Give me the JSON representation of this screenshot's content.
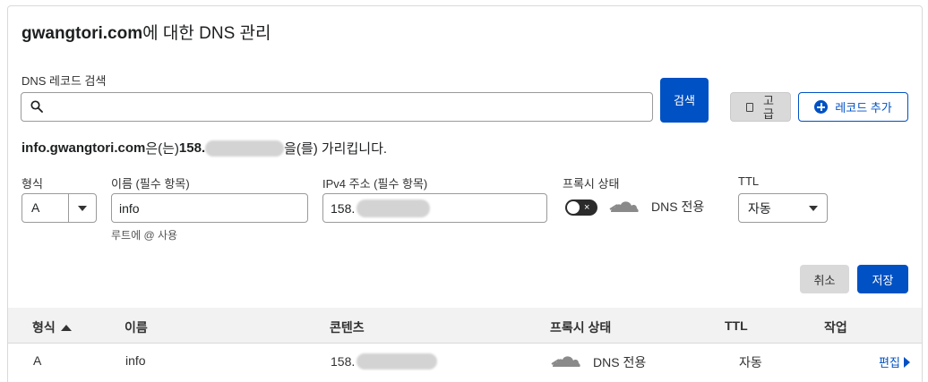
{
  "page": {
    "title_domain": "gwangtori.com",
    "title_suffix": "에 대한 DNS 관리"
  },
  "search": {
    "label": "DNS 레코드 검색",
    "value": "",
    "placeholder": "",
    "search_button": "검색",
    "advanced_button": "고급",
    "add_record_button": "레코드 추가"
  },
  "points_to": {
    "host": "info.gwangtori.com",
    "mid": "은(는) ",
    "ip_visible": "158.",
    "suffix": "을(를) 가리킵니다."
  },
  "form": {
    "type_label": "형식",
    "type_value": "A",
    "name_label": "이름 (필수 항목)",
    "name_value": "info",
    "name_hint": "루트에 @ 사용",
    "ipv4_label": "IPv4 주소 (필수 항목)",
    "ipv4_value": "158.",
    "proxy_label": "프록시 상태",
    "proxy_toggle_mark": "×",
    "proxy_text": "DNS 전용",
    "ttl_label": "TTL",
    "ttl_value": "자동",
    "cancel_button": "취소",
    "save_button": "저장"
  },
  "table": {
    "headers": {
      "type": "형식",
      "name": "이름",
      "content": "콘텐츠",
      "proxy": "프록시 상태",
      "ttl": "TTL",
      "action": "작업"
    },
    "rows": [
      {
        "type": "A",
        "name": "info",
        "content": "158.",
        "proxy": "DNS 전용",
        "ttl": "자동",
        "action": "편집"
      }
    ]
  },
  "colors": {
    "primary": "#0051c3",
    "secondary_button": "#d9d9d9",
    "header_bg": "#f2f2f2",
    "cloud_grey": "#8a8a8a"
  },
  "icons": {
    "search": "magnifier-icon",
    "add": "plus-circle-icon",
    "advanced": "document-icon",
    "proxy": "cloud-icon",
    "sort": "sort-ascending-icon",
    "edit": "caret-right-icon"
  }
}
